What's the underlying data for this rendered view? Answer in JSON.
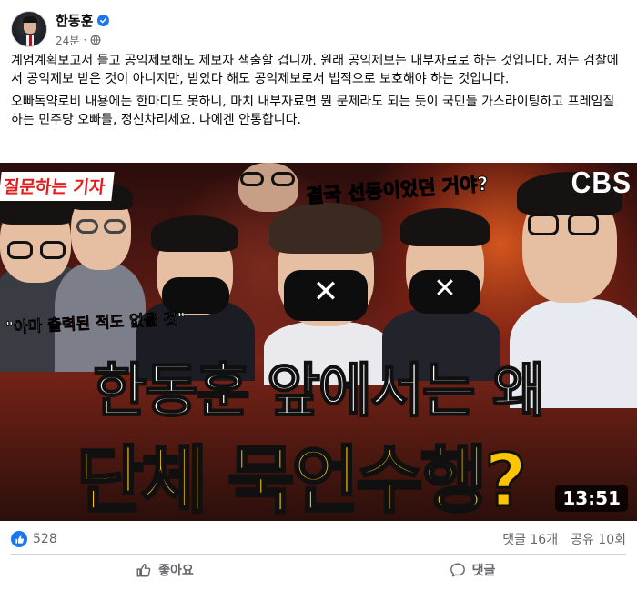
{
  "post": {
    "author": "한동훈",
    "time": "24분",
    "separator": "·",
    "paragraphs": [
      "계엄계획보고서 들고 공익제보해도 제보자 색출할 겁니까. 원래 공익제보는 내부자료로 하는 것입니다. 저는 검찰에서 공익제보 받은 것이 아니지만, 받았다 해도 공익제보로서 법적으로 보호해야 하는 것입니다.",
      "오빠독약로비 내용에는 한마디도 못하니, 마치 내부자료면 뭔 문제라도 되는 듯이 국민들 가스라이팅하고 프레임질하는 민주당 오빠들, 정신차리세요. 나에겐 안통합니다."
    ]
  },
  "media": {
    "tag": "질문하는 기자",
    "channel": "CBS",
    "caption_top_1": "결국 ",
    "caption_top_accent": "선동이었던",
    "caption_top_2": " 거야?",
    "quote_1": "\"아마 ",
    "quote_accent": "출력된 적도",
    "quote_2": " 없을 것\"",
    "headline_line1": "한동훈 앞에서는 왜",
    "headline_line2": "단체 묵언수행?",
    "mask_mark": "✕",
    "duration": "13:51"
  },
  "stats": {
    "reactions": "528",
    "comments": "댓글 16개",
    "shares": "공유 10회"
  },
  "actions": {
    "like": "좋아요",
    "comment": "댓글"
  },
  "colors": {
    "accent": "#1877f2",
    "headline_yellow": "#ffc400",
    "caption_red": "#ff2e2e"
  }
}
